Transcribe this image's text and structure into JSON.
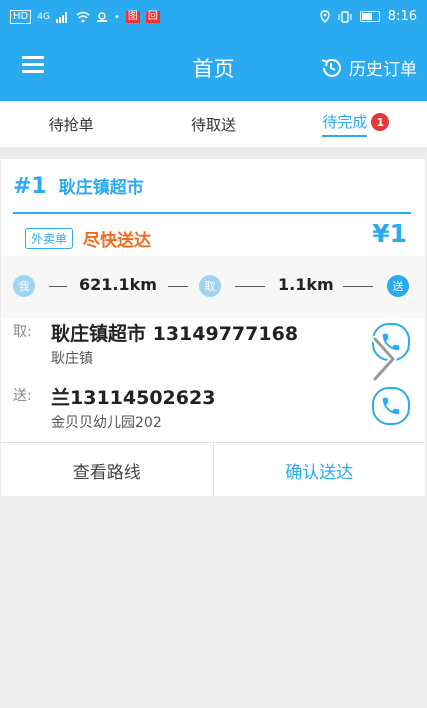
{
  "status_bar": {
    "left_chip": "HD",
    "network": "4G",
    "red_icons": [
      "图",
      "回"
    ],
    "time": "8:16"
  },
  "header": {
    "title": "首页",
    "history_label": "历史订单"
  },
  "tabs": [
    {
      "label": "待抢单",
      "active": false
    },
    {
      "label": "待取送",
      "active": false
    },
    {
      "label": "待完成",
      "active": true,
      "badge": "1"
    }
  ],
  "order": {
    "number": "#1",
    "shop": "耿庄镇超市",
    "type_tag": "外卖单",
    "urgency": "尽快送达",
    "price": "¥1",
    "route": {
      "me_label": "我",
      "dist_to_pickup": "621.1km",
      "pickup_label": "取",
      "dist_to_dropoff": "1.1km",
      "dropoff_label": "送"
    },
    "pickup": {
      "label": "取:",
      "name_phone": "耿庄镇超市 13149777168",
      "address": "耿庄镇"
    },
    "dropoff": {
      "label": "送:",
      "name_phone": "兰13114502623",
      "address": "金贝贝幼儿园202"
    },
    "actions": {
      "route_label": "查看路线",
      "confirm_label": "确认送达"
    }
  },
  "colors": {
    "primary": "#2aaaf0",
    "urgency": "#f26b1d",
    "badge": "#e53935",
    "background": "#ececec"
  }
}
